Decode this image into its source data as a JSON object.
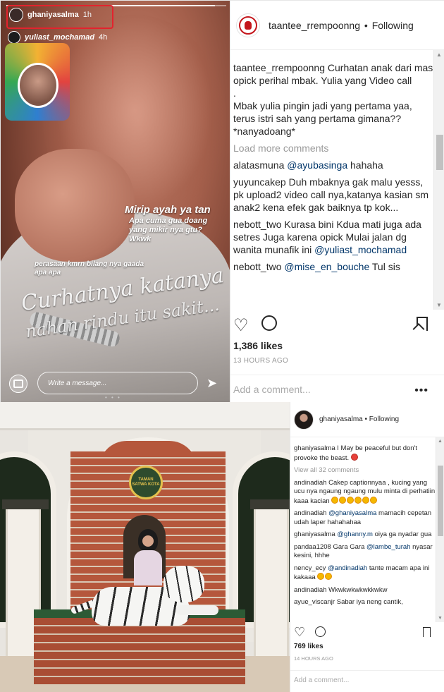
{
  "post1": {
    "story": {
      "progress_fraction": 0.95,
      "username": "ghaniyasalma",
      "time": "1h",
      "mention_user": "yuliast_mochamad",
      "mention_time": "4h",
      "texts": {
        "line1": "Mirip ayah ya tan",
        "line2": "Apa cuma gua doang yang mikir nya gtu? Wkwk",
        "line3": "perasaan kmrn bilang nya gaada apa apa",
        "line4": "Curhatnya katanya",
        "line5": "nahan rindu itu sakit..."
      },
      "reply_placeholder": "Write a message...",
      "highlight_color": "#e3232d"
    },
    "header": {
      "username": "taantee_rrempoonng",
      "separator": "•",
      "follow_status": "Following"
    },
    "caption": {
      "username": "taantee_rrempoonng",
      "text": "Curhatan anak dari mas opick perihal mbak. Yulia yang Video call\n.\nMbak yulia pingin jadi yang pertama yaa, terus istri sah yang pertama gimana?? *nanyadoang*"
    },
    "load_more": "Load more comments",
    "comments": [
      {
        "user": "alatasmuna",
        "mention": "@ayubasinga",
        "text": " hahaha"
      },
      {
        "user": "yuyuncakep",
        "mention": "",
        "text": " Duh mbaknya gak malu yesss, pk upload2 video call nya,katanya kasian sm anak2 kena efek gak baiknya tp kok..."
      },
      {
        "user": "nebott_two",
        "mention": "",
        "text": " Kurasa bini Kdua mati juga ada setres Juga karena opick Mulai jalan dg wanita munafik ini",
        "trailing_mention": "@yuliast_mochamad"
      },
      {
        "user": "nebott_two",
        "mention": "@mise_en_bouche",
        "text": " Tul sis"
      }
    ],
    "likes": "1,386 likes",
    "time": "13 HOURS AGO",
    "add_comment": "Add a comment...",
    "more": "•••"
  },
  "post2": {
    "emblem_text": "TAMAN SATWA KOTA",
    "header": {
      "username": "ghaniyasalma",
      "separator": "•",
      "follow_status": "Following"
    },
    "caption": {
      "username": "ghaniyasalma",
      "text": "I May be peaceful but don't provoke the beast."
    },
    "view_all": "View all 32 comments",
    "comments": [
      {
        "user": "andinadiah",
        "mention": "",
        "text": " Cakep captionnyaa , kucing yang ucu nya ngaung ngaung mulu minta di perhatiin kaaa kacian",
        "emoji": 6
      },
      {
        "user": "andinadiah",
        "mention": "@ghaniyasalma",
        "text": " mamacih cepetan udah laper hahahahaa"
      },
      {
        "user": "ghaniyasalma",
        "mention": "@ghanny.m",
        "text": " oiya ga nyadar gua"
      },
      {
        "user": "pandaa1208",
        "mention": "",
        "text": " Gara Gara ",
        "trailing_mention": "@lambe_turah",
        "after": " nyasar kesini, hhhe"
      },
      {
        "user": "nency_ecy",
        "mention": "@andinadiah",
        "text": " tante macam apa ini kakaaa",
        "emoji": 2
      },
      {
        "user": "andinadiah",
        "mention": "",
        "text": " Wkwkwkwkwkkwkw"
      },
      {
        "user": "ayue_viscanjr",
        "mention": "",
        "text": " Sabar iya neng cantik,"
      }
    ],
    "likes": "769 likes",
    "time": "14 HOURS AGO",
    "add_comment": "Add a comment..."
  }
}
